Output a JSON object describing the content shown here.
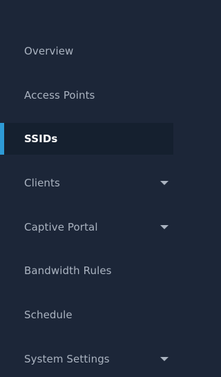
{
  "sidebar": {
    "items": [
      {
        "label": "Overview",
        "active": false,
        "has_submenu": false
      },
      {
        "label": "Access Points",
        "active": false,
        "has_submenu": false
      },
      {
        "label": "SSIDs",
        "active": true,
        "has_submenu": false
      },
      {
        "label": "Clients",
        "active": false,
        "has_submenu": true
      },
      {
        "label": "Captive Portal",
        "active": false,
        "has_submenu": true
      },
      {
        "label": "Bandwidth Rules",
        "active": false,
        "has_submenu": false
      },
      {
        "label": "Schedule",
        "active": false,
        "has_submenu": false
      },
      {
        "label": "System Settings",
        "active": false,
        "has_submenu": true
      }
    ],
    "colors": {
      "background": "#1c2638",
      "active_background": "#15202f",
      "active_indicator": "#2e9bd6",
      "text": "#aab3c0",
      "active_text": "#ffffff"
    }
  }
}
